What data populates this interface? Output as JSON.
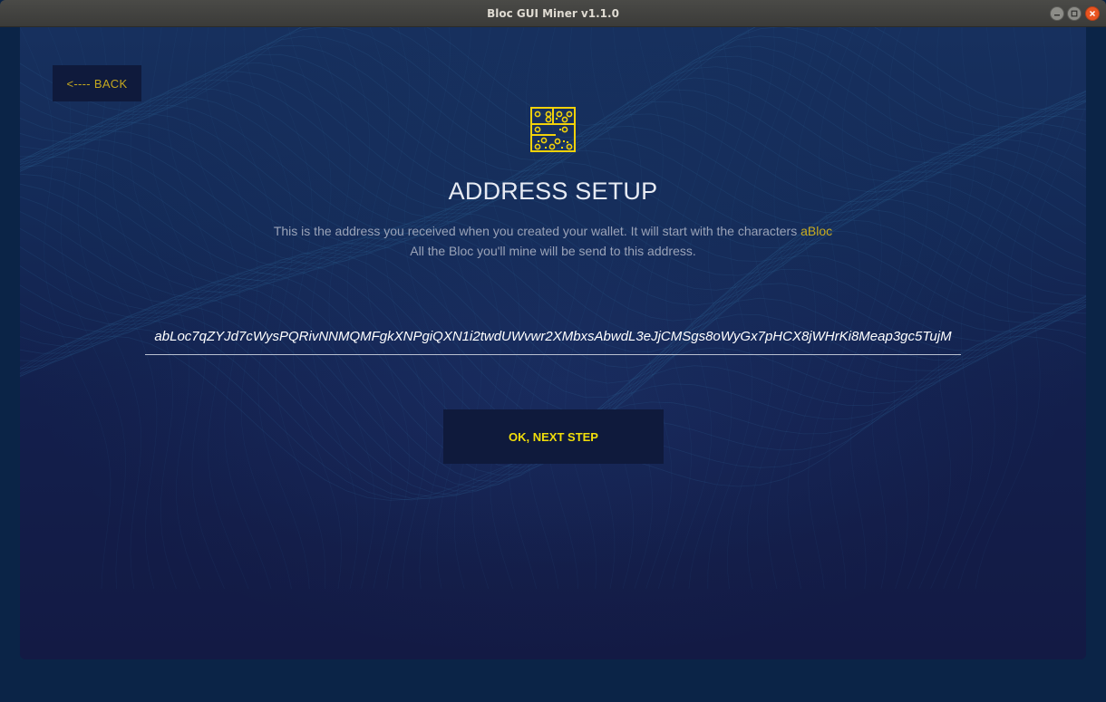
{
  "window": {
    "title": "Bloc GUI Miner v1.1.0",
    "controls": {
      "minimize_icon": "minimize-icon",
      "maximize_icon": "maximize-icon",
      "close_icon": "close-icon"
    }
  },
  "back_button": {
    "label": "<---- BACK"
  },
  "logo": {
    "icon": "bloc-circuit-logo-icon"
  },
  "heading": "ADDRESS SETUP",
  "description": {
    "line1_text": "This is the address you received when you created your wallet. It will start with the characters ",
    "line1_accent": "aBloc",
    "line2": "All the Bloc you'll mine will be send to this address."
  },
  "address_input": {
    "value": "abLoc7qZYJd7cWysPQRivNNMQMFgkXNPgiQXN1i2twdUWvwr2XMbxsAbwdL3eJjCMSgs8oWyGx7pHCX8jWHrKi8Meap3gc5TujM"
  },
  "next_button": {
    "label": "OK, NEXT STEP"
  },
  "colors": {
    "accent_yellow": "#f2de0a",
    "accent_gold": "#c9ac1f",
    "panel_bg": "#14295a",
    "button_bg": "#0f1a3c"
  }
}
